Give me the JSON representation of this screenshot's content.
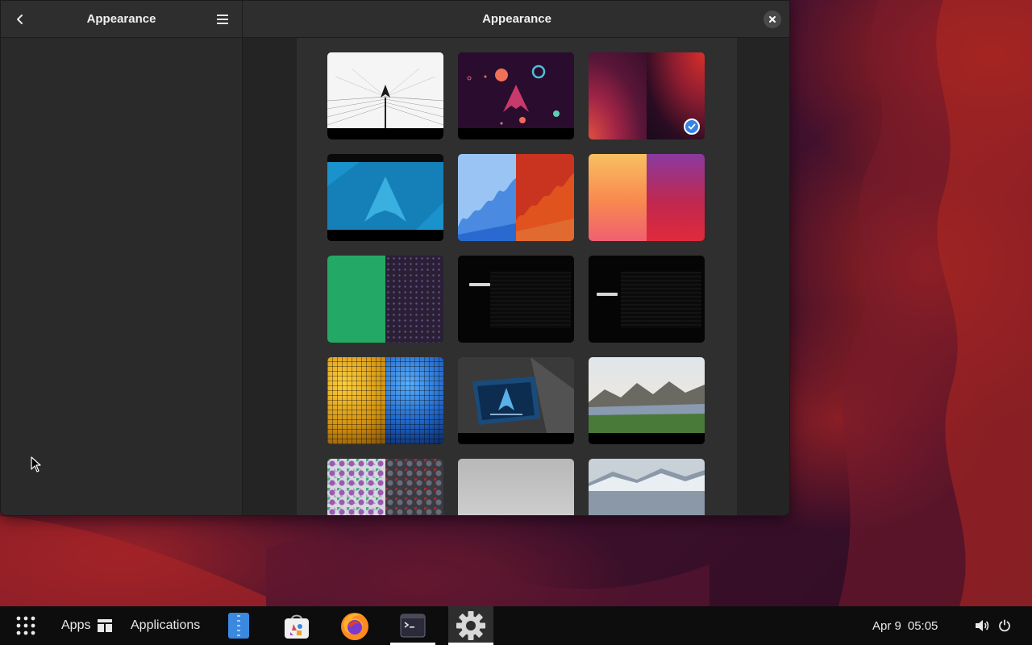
{
  "window": {
    "sidebar_title": "Appearance",
    "main_title": "Appearance"
  },
  "wallpapers": [
    {
      "name": "wallpaper-top-left-partial",
      "selected": false
    },
    {
      "name": "wallpaper-top-middle-partial",
      "selected": false
    },
    {
      "name": "wallpaper-top-right-partial",
      "selected": false
    },
    {
      "name": "wallpaper-arch-sketch",
      "selected": false
    },
    {
      "name": "wallpaper-arch-planets",
      "selected": false
    },
    {
      "name": "wallpaper-red-waves",
      "selected": true
    },
    {
      "name": "wallpaper-arch-blue",
      "selected": false
    },
    {
      "name": "wallpaper-drip-blue-orange",
      "selected": false
    },
    {
      "name": "wallpaper-gradient-sunset",
      "selected": false
    },
    {
      "name": "wallpaper-green-dots",
      "selected": false
    },
    {
      "name": "wallpaper-archlinux-dark-1",
      "selected": false
    },
    {
      "name": "wallpaper-archlinux-dark-2",
      "selected": false
    },
    {
      "name": "wallpaper-mosaic-gold-blue",
      "selected": false
    },
    {
      "name": "wallpaper-arch-tv",
      "selected": false
    },
    {
      "name": "wallpaper-mountain-lake",
      "selected": false
    },
    {
      "name": "wallpaper-hex-tiles",
      "selected": false
    },
    {
      "name": "wallpaper-misty-fog",
      "selected": false
    },
    {
      "name": "wallpaper-snowy-mountains",
      "selected": false
    }
  ],
  "taskbar": {
    "apps_label": "Apps",
    "applications_label": "Applications",
    "date": "Apr 9",
    "time": "05:05",
    "icons": {
      "app_grid": "app-grid-icon",
      "files": "files-icon",
      "software": "software-store-icon",
      "firefox": "firefox-icon",
      "terminal": "terminal-icon",
      "settings": "settings-gear-icon",
      "volume": "volume-icon",
      "power": "power-icon"
    }
  },
  "colors": {
    "accent": "#3584e4",
    "window_bg": "#242424",
    "header_bg": "#2e2e2e",
    "taskbar_bg": "#0d0d0d"
  }
}
